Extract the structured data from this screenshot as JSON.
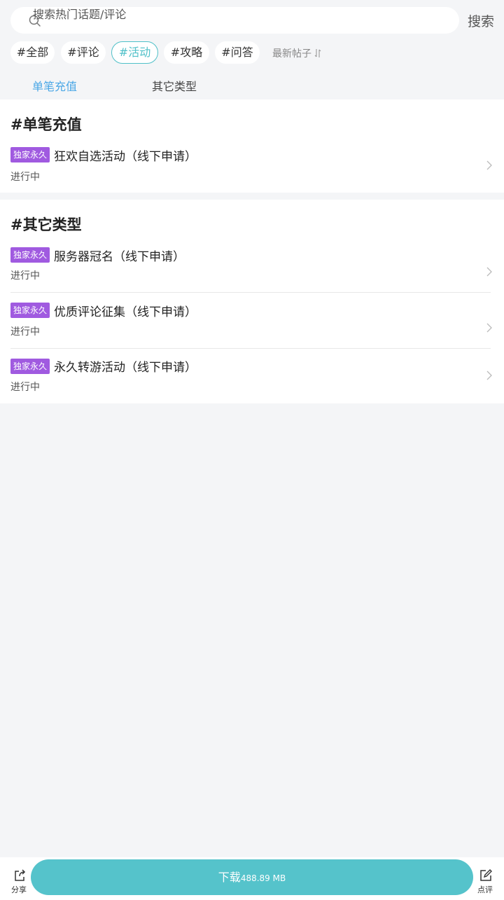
{
  "search": {
    "placeholder": "搜索热门话题/评论",
    "button_label": "搜索"
  },
  "tags": [
    {
      "label": "#全部",
      "active": false
    },
    {
      "label": "#评论",
      "active": false
    },
    {
      "label": "#活动",
      "active": true
    },
    {
      "label": "#攻略",
      "active": false
    },
    {
      "label": "#问答",
      "active": false
    }
  ],
  "sort": {
    "label": "最新帖子",
    "icon": "sort-arrows-icon"
  },
  "tabs": [
    {
      "label": "单笔充值",
      "active": true
    },
    {
      "label": "其它类型",
      "active": false
    }
  ],
  "sections": [
    {
      "title": "#单笔充值",
      "items": [
        {
          "badge": "独家永久",
          "title": "狂欢自选活动（线下申请）",
          "status": "进行中"
        }
      ]
    },
    {
      "title": "#其它类型",
      "items": [
        {
          "badge": "独家永久",
          "title": "服务器冠名（线下申请）",
          "status": "进行中"
        },
        {
          "badge": "独家永久",
          "title": "优质评论征集（线下申请）",
          "status": "进行中"
        },
        {
          "badge": "独家永久",
          "title": "永久转游活动（线下申请）",
          "status": "进行中"
        }
      ]
    }
  ],
  "bottom": {
    "share_label": "分享",
    "review_label": "点评",
    "download_label": "下载",
    "download_size": "488.89 MB"
  },
  "colors": {
    "accent": "#4fc0c8",
    "tab_active": "#4aa7e6",
    "badge": "#a05ae0",
    "download": "#55c3cb",
    "background": "#f4f5f7"
  }
}
